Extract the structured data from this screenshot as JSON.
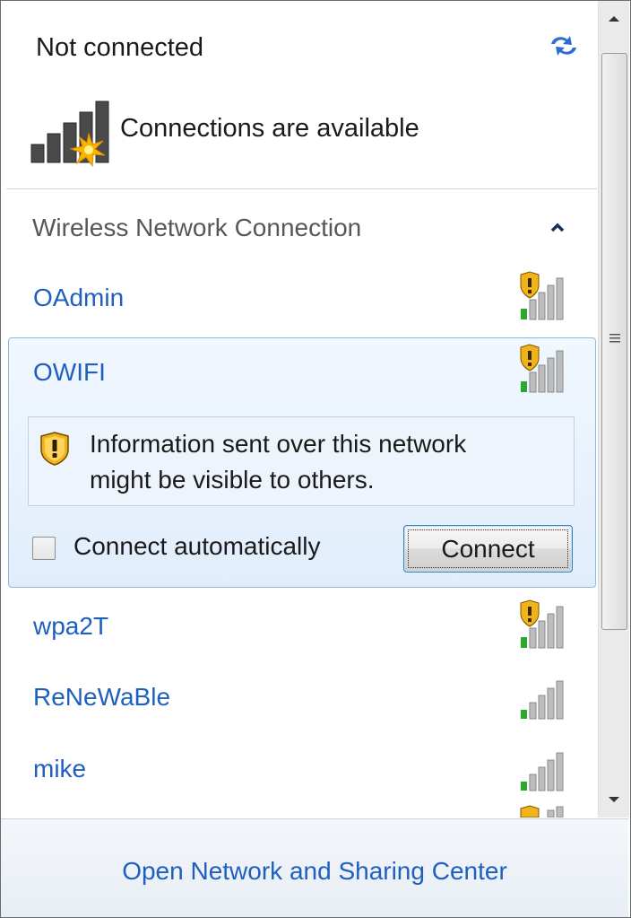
{
  "header": {
    "status": "Not connected",
    "availability": "Connections are available",
    "refresh_icon": "refresh-arrows-icon",
    "signal_icon": "no-connection-signal-icon"
  },
  "section": {
    "title": "Wireless Network Connection",
    "collapse_icon": "chevron-up-icon"
  },
  "networks": [
    {
      "name": "OAdmin",
      "secured": false,
      "signal_bars": 4
    },
    {
      "name": "OWIFI",
      "secured": false,
      "signal_bars": 4,
      "expanded": true
    },
    {
      "name": "wpa2T",
      "secured": false,
      "signal_bars": 4
    },
    {
      "name": "ReNeWaBle",
      "secured": true,
      "signal_bars": 4
    },
    {
      "name": "mike",
      "secured": true,
      "signal_bars": 4
    }
  ],
  "expanded": {
    "warning_line1": "Information sent over this network",
    "warning_line2": "might be visible to others.",
    "auto_connect_label": "Connect automatically",
    "auto_connect_checked": false,
    "connect_label": "Connect"
  },
  "footer": {
    "link": "Open Network and Sharing Center"
  },
  "colors": {
    "link": "#1f5fbf",
    "selection_border": "#8fb7e0",
    "shield": "#e8a317"
  }
}
